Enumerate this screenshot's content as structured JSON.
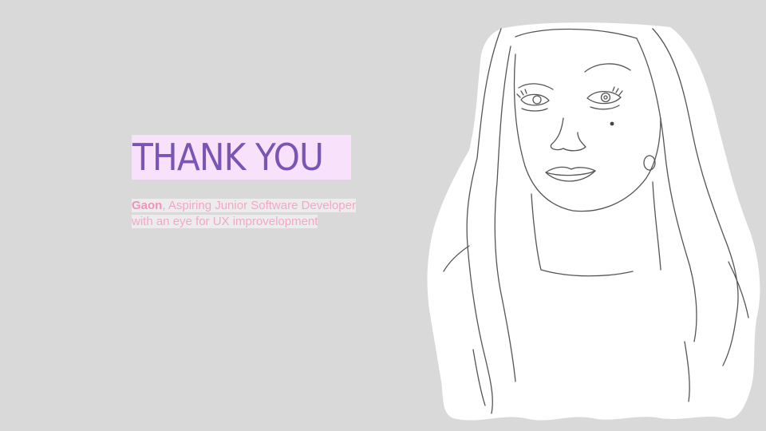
{
  "slide": {
    "title": "THANK YOU",
    "subtitle": {
      "name": "Gaon",
      "line1_rest": ", Aspiring Junior Software Developer",
      "line2": "with an eye for UX improvelopment"
    },
    "portrait": {
      "icon": "portrait-sketch-icon"
    }
  },
  "colors": {
    "background": "#d9d9d9",
    "title_highlight": "#f8e2fb",
    "title_text": "#7a55b3",
    "subtitle_text": "#f4a6c9",
    "subtitle_name": "#f291bd",
    "portrait_fill": "#ffffff",
    "sketch_line": "#555555"
  }
}
